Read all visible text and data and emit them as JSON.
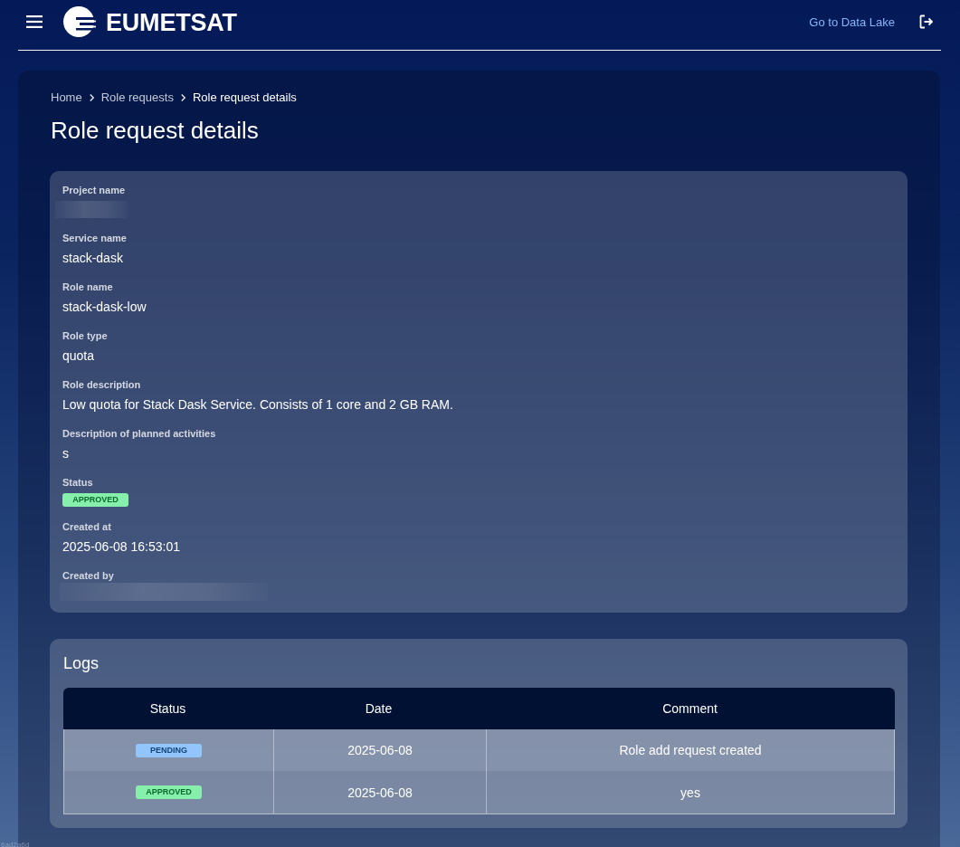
{
  "header": {
    "logo_text": "EUMETSAT",
    "link": "Go to Data Lake"
  },
  "breadcrumb": [
    {
      "label": "Home",
      "current": false
    },
    {
      "label": "Role requests",
      "current": false
    },
    {
      "label": "Role request details",
      "current": true
    }
  ],
  "title": "Role request details",
  "details": {
    "fields": [
      {
        "label": "Project name",
        "kind": "redacted"
      },
      {
        "label": "Service name",
        "kind": "text",
        "value": "stack-dask"
      },
      {
        "label": "Role name",
        "kind": "text",
        "value": "stack-dask-low"
      },
      {
        "label": "Role type",
        "kind": "text",
        "value": "quota"
      },
      {
        "label": "Role description",
        "kind": "text",
        "value": "Low quota for Stack Dask Service. Consists of 1 core and 2 GB RAM."
      },
      {
        "label": "Description of planned activities",
        "kind": "text",
        "value": "s"
      },
      {
        "label": "Status",
        "kind": "badge",
        "value": "APPROVED",
        "color": "#86efac"
      },
      {
        "label": "Created at",
        "kind": "text",
        "value": "2025-06-08 16:53:01"
      },
      {
        "label": "Created by",
        "kind": "redacted"
      }
    ]
  },
  "logs": {
    "title": "Logs",
    "columns": [
      "Status",
      "Date",
      "Comment"
    ],
    "rows": [
      {
        "status": "PENDING",
        "color": "#93c5fd",
        "date": "2025-06-08",
        "comment": "Role add request created"
      },
      {
        "status": "APPROVED",
        "color": "#86efac",
        "date": "2025-06-08",
        "comment": "yes"
      }
    ]
  },
  "build": "6ad2a6d"
}
